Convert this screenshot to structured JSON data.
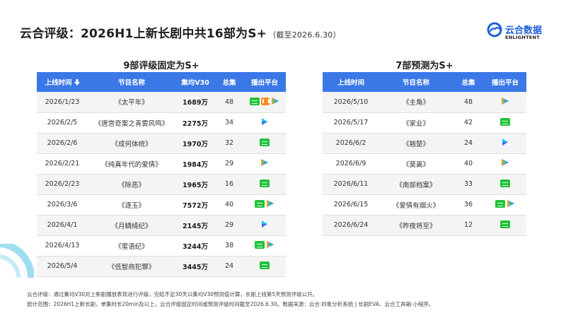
{
  "header": {
    "title": "云合评级：2026H1上新长剧中共16部为S+",
    "date_note": "（截至2026.6.30）"
  },
  "logo": {
    "name_cn": "云合数据",
    "name_en": "ENLIGHTENT",
    "color": "#1e5fd8"
  },
  "colors": {
    "header_blue": "#3a78e8",
    "iqiyi": "#21c23c",
    "mango": "#ff8a1f"
  },
  "left": {
    "title": "9部评级固定为S+",
    "columns": [
      "上线时间",
      "节目名称",
      "集均V30",
      "总集",
      "播出平台"
    ],
    "rows": [
      {
        "date": "2026/1/23",
        "name": "《太平年》",
        "views": "1689万",
        "eps": "48",
        "platforms": [
          "iqiyi",
          "mango",
          "tencent"
        ]
      },
      {
        "date": "2026/2/5",
        "name": "《唐宫奇案之青雾风鸣》",
        "views": "2275万",
        "eps": "34",
        "platforms": [
          "youku"
        ]
      },
      {
        "date": "2026/2/6",
        "name": "《成何体统》",
        "views": "1970万",
        "eps": "32",
        "platforms": [
          "iqiyi"
        ]
      },
      {
        "date": "2026/2/21",
        "name": "《纯真年代的爱情》",
        "views": "1984万",
        "eps": "29",
        "platforms": [
          "tencent"
        ]
      },
      {
        "date": "2026/2/23",
        "name": "《除恶》",
        "views": "1965万",
        "eps": "16",
        "platforms": [
          "iqiyi"
        ]
      },
      {
        "date": "2026/3/6",
        "name": "《逐玉》",
        "views": "7572万",
        "eps": "40",
        "platforms": [
          "iqiyi",
          "tencent"
        ]
      },
      {
        "date": "2026/4/1",
        "name": "《月鳞绮纪》",
        "views": "2145万",
        "eps": "29",
        "platforms": [
          "youku"
        ]
      },
      {
        "date": "2026/4/13",
        "name": "《蜜语纪》",
        "views": "3244万",
        "eps": "38",
        "platforms": [
          "iqiyi",
          "tencent"
        ]
      },
      {
        "date": "2026/5/4",
        "name": "《低智商犯罪》",
        "views": "3445万",
        "eps": "24",
        "platforms": [
          "iqiyi"
        ]
      }
    ]
  },
  "right": {
    "title": "7部预测为S+",
    "columns": [
      "上线时间",
      "节目名称",
      "总集",
      "播出平台"
    ],
    "rows": [
      {
        "date": "2026/5/10",
        "name": "《主角》",
        "eps": "48",
        "platforms": [
          "tencent"
        ]
      },
      {
        "date": "2026/5/17",
        "name": "《家业》",
        "eps": "42",
        "platforms": [
          "iqiyi"
        ]
      },
      {
        "date": "2026/6/2",
        "name": "《翘楚》",
        "eps": "24",
        "platforms": [
          "youku"
        ]
      },
      {
        "date": "2026/6/9",
        "name": "《莫离》",
        "eps": "40",
        "platforms": [
          "tencent"
        ]
      },
      {
        "date": "2026/6/11",
        "name": "《南部档案》",
        "eps": "33",
        "platforms": [
          "iqiyi"
        ]
      },
      {
        "date": "2026/6/15",
        "name": "《爱情有烟火》",
        "eps": "36",
        "platforms": [
          "iqiyi",
          "tencent"
        ]
      },
      {
        "date": "2026/6/24",
        "name": "《昨夜将至》",
        "eps": "12",
        "platforms": [
          "iqiyi"
        ]
      }
    ]
  },
  "notes": {
    "line1": "云合评级：通过集均V30对上新剧播放表现进行评级，完结不足30天以集均V30预测值计算，长剧上线第5天预测评级公开。",
    "line2": "统计范围：2026H1上新长剧，单集时长20min及以上，云合评级固定时间或预测评级时间截至2026.6.30。数据来源：云合·四象分析系统 | 长剧EVA、云合工具箱·小程序。"
  }
}
